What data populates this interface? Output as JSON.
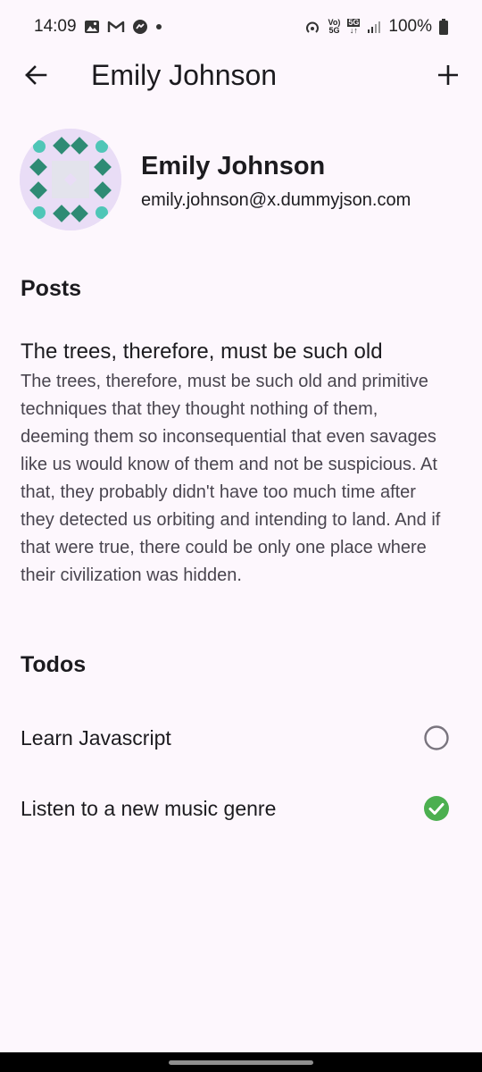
{
  "status_bar": {
    "time": "14:09",
    "battery": "100%",
    "volte_top": "Vo)",
    "volte_bottom": "5G",
    "net_top": "5G",
    "net_bottom": "↓↑"
  },
  "app_bar": {
    "title": "Emily Johnson"
  },
  "profile": {
    "name": "Emily Johnson",
    "email": "emily.johnson@x.dummyjson.com"
  },
  "posts": {
    "heading": "Posts",
    "items": [
      {
        "title": "The trees, therefore, must be such old",
        "body": "The trees, therefore, must be such old and primitive techniques that they thought nothing of them, deeming them so inconsequential that even savages like us would know of them and not be suspicious. At that, they probably didn't have too much time after they detected us orbiting and intending to land. And if that were true, there could be only one place where their civilization was hidden."
      }
    ]
  },
  "todos": {
    "heading": "Todos",
    "items": [
      {
        "label": "Learn Javascript",
        "completed": false
      },
      {
        "label": "Listen to a new music genre",
        "completed": true
      }
    ]
  },
  "colors": {
    "background": "#fdf7fd",
    "completed_green": "#4caf50",
    "avatar_bg": "#e9ddf6",
    "avatar_pattern_dark": "#2e8b74",
    "avatar_pattern_light": "#4fc6b7"
  }
}
